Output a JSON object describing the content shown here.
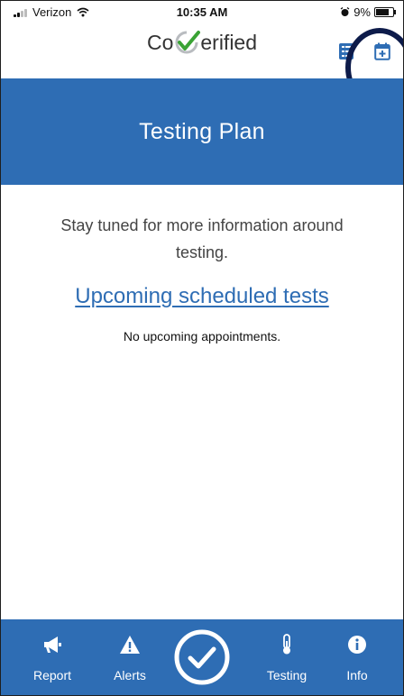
{
  "status_bar": {
    "carrier": "Verizon",
    "time": "10:35 AM",
    "battery": "9%"
  },
  "header": {
    "logo_prefix": "Co",
    "logo_suffix": "erified",
    "icons": [
      "list-icon",
      "calendar-add-icon"
    ]
  },
  "banner": {
    "title": "Testing Plan"
  },
  "content": {
    "info_text": "Stay tuned for more information around testing.",
    "section_link": "Upcoming scheduled tests",
    "empty_text": "No upcoming appointments."
  },
  "bottom_nav": {
    "items": [
      {
        "label": "Report",
        "icon": "megaphone-icon"
      },
      {
        "label": "Alerts",
        "icon": "warning-icon"
      },
      {
        "label": "",
        "icon": "check-circle-icon"
      },
      {
        "label": "Testing",
        "icon": "thermometer-icon"
      },
      {
        "label": "Info",
        "icon": "info-icon"
      }
    ]
  },
  "colors": {
    "primary": "#2e6db4",
    "highlight_ring": "#0d1b4a",
    "logo_check": "#3aa335"
  }
}
